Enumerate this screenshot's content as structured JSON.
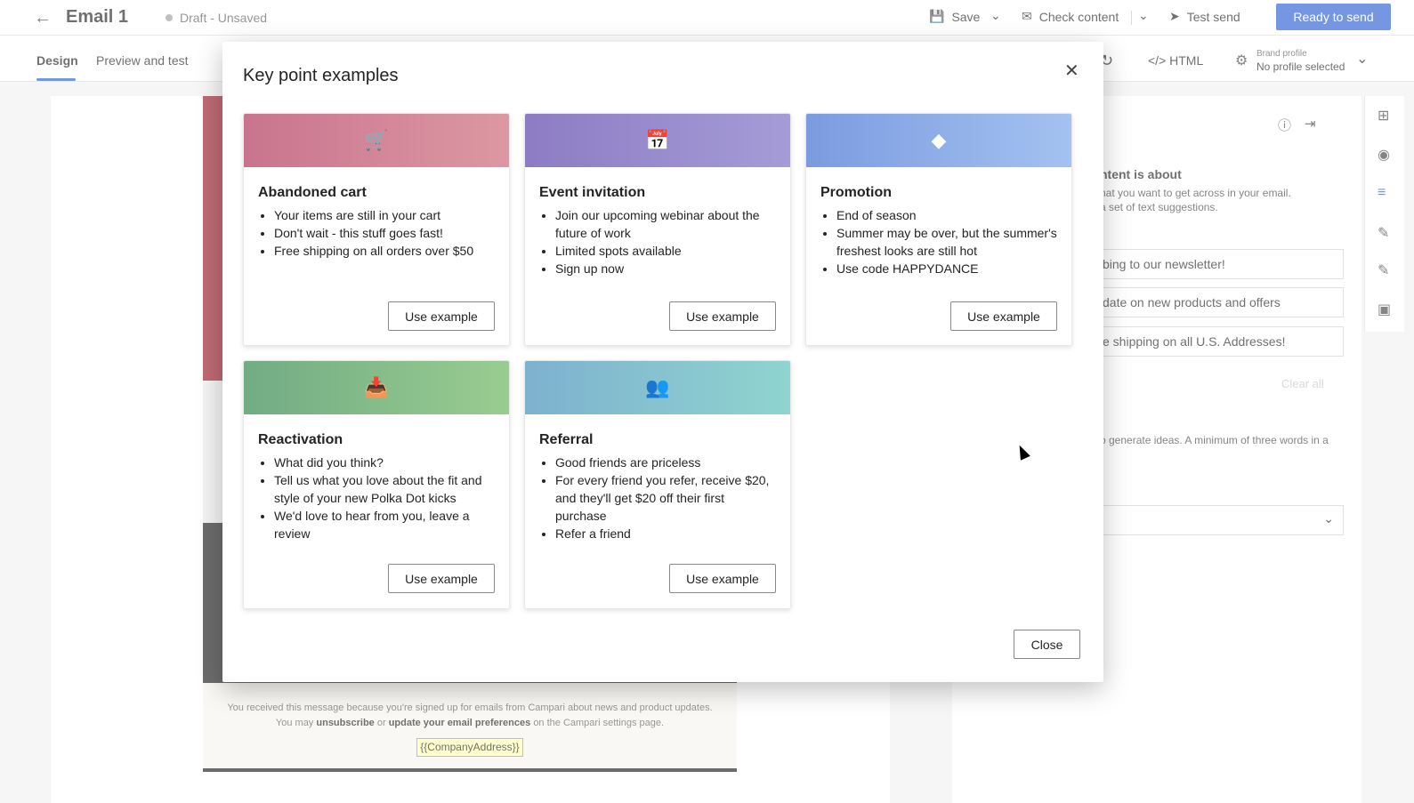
{
  "topbar": {
    "back_icon": "arrow-left-icon",
    "title": "Email 1",
    "status": "Draft - Unsaved",
    "save_label": "Save",
    "check_content_label": "Check content",
    "test_send_label": "Test send",
    "ready_label": "Ready to send"
  },
  "tabs": [
    {
      "label": "Design"
    },
    {
      "label": "Preview and test"
    }
  ],
  "toolbar": {
    "html_label": "HTML",
    "brand_profile_caption": "Brand profile",
    "brand_profile_value": "No profile selected"
  },
  "email_footer": {
    "line1": "You received this message because you're signed up for emails from Campari about news and product updates.",
    "line2_a": "You may",
    "unsubscribe": "unsubscribe",
    "line2_b": "or",
    "update_prefs": "update your email preferences",
    "line2_c": "on the Campari settings page.",
    "company_address": "{{CompanyAddress}}"
  },
  "right_panel": {
    "heading": "ntent is about",
    "desc1": "hat you want to get across in your email.",
    "desc2": "a set of text suggestions.",
    "input1": "bing to our newsletter!",
    "input2": "date on new products and offers",
    "input3": "e shipping on all U.S. Addresses!",
    "clear_all": "Clear all",
    "hint": "o generate ideas. A minimum of three words in a"
  },
  "modal": {
    "title": "Key point examples",
    "close_label": "Close",
    "cards": [
      {
        "title": "Abandoned cart",
        "icon": "cart-icon",
        "color_from": "#c9748f",
        "color_to": "#dc98a2",
        "points": [
          "Your items are still in your cart",
          "Don't wait - this stuff goes fast!",
          "Free shipping on all orders over $50"
        ],
        "button": "Use example"
      },
      {
        "title": "Event invitation",
        "icon": "calendar-icon",
        "color_from": "#8d7cc4",
        "color_to": "#a59cd6",
        "points": [
          "Join our upcoming webinar about the future of work",
          "Limited spots available",
          "Sign up now"
        ],
        "button": "Use example"
      },
      {
        "title": "Promotion",
        "icon": "ticket-icon",
        "color_from": "#7c9be0",
        "color_to": "#a3c2f0",
        "points": [
          "End of season",
          "Summer may be over, but the summer's freshest looks are still hot",
          "Use code HAPPYDANCE"
        ],
        "button": "Use example"
      },
      {
        "title": "Reactivation",
        "icon": "inbox-icon",
        "color_from": "#72ac84",
        "color_to": "#99cc90",
        "points": [
          "What did you think?",
          "Tell us what you love about the fit and style of your new Polka Dot kicks",
          "We'd love to hear from you, leave a review"
        ],
        "button": "Use example"
      },
      {
        "title": "Referral",
        "icon": "people-icon",
        "color_from": "#7eb1cf",
        "color_to": "#8fd4cf",
        "points": [
          "Good friends are priceless",
          "For every friend you refer, receive $20, and they'll get $20 off their first purchase",
          "Refer a friend"
        ],
        "button": "Use example"
      }
    ]
  }
}
